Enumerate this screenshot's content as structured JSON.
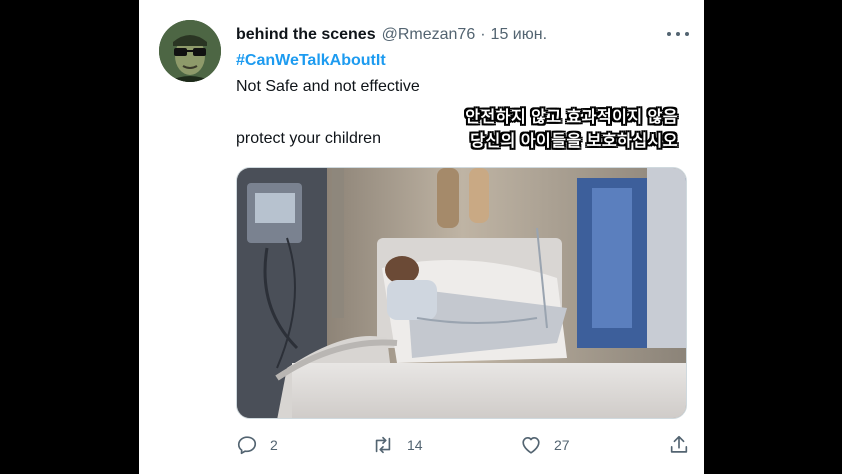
{
  "tweet": {
    "display_name": "behind the scenes",
    "handle": "@Rmezan76",
    "separator": "·",
    "date": "15 июн.",
    "hashtag": "#CanWeTalkAboutIt",
    "text_line1": "Not Safe and not effective",
    "text_line2": "protect your children"
  },
  "subtitles": {
    "line1": "안전하지 않고 효과적이지 않음",
    "line2": "당신의 아이들을 보호하십시오"
  },
  "stats": {
    "replies": "2",
    "retweets": "14",
    "likes": "27"
  },
  "icons": {
    "more": "more-icon",
    "reply": "reply-icon",
    "retweet": "retweet-icon",
    "like": "heart-icon",
    "share": "share-icon"
  },
  "colors": {
    "background": "#000000",
    "card": "#ffffff",
    "text": "#0f1419",
    "secondary": "#536471",
    "link": "#1d9bf0"
  }
}
